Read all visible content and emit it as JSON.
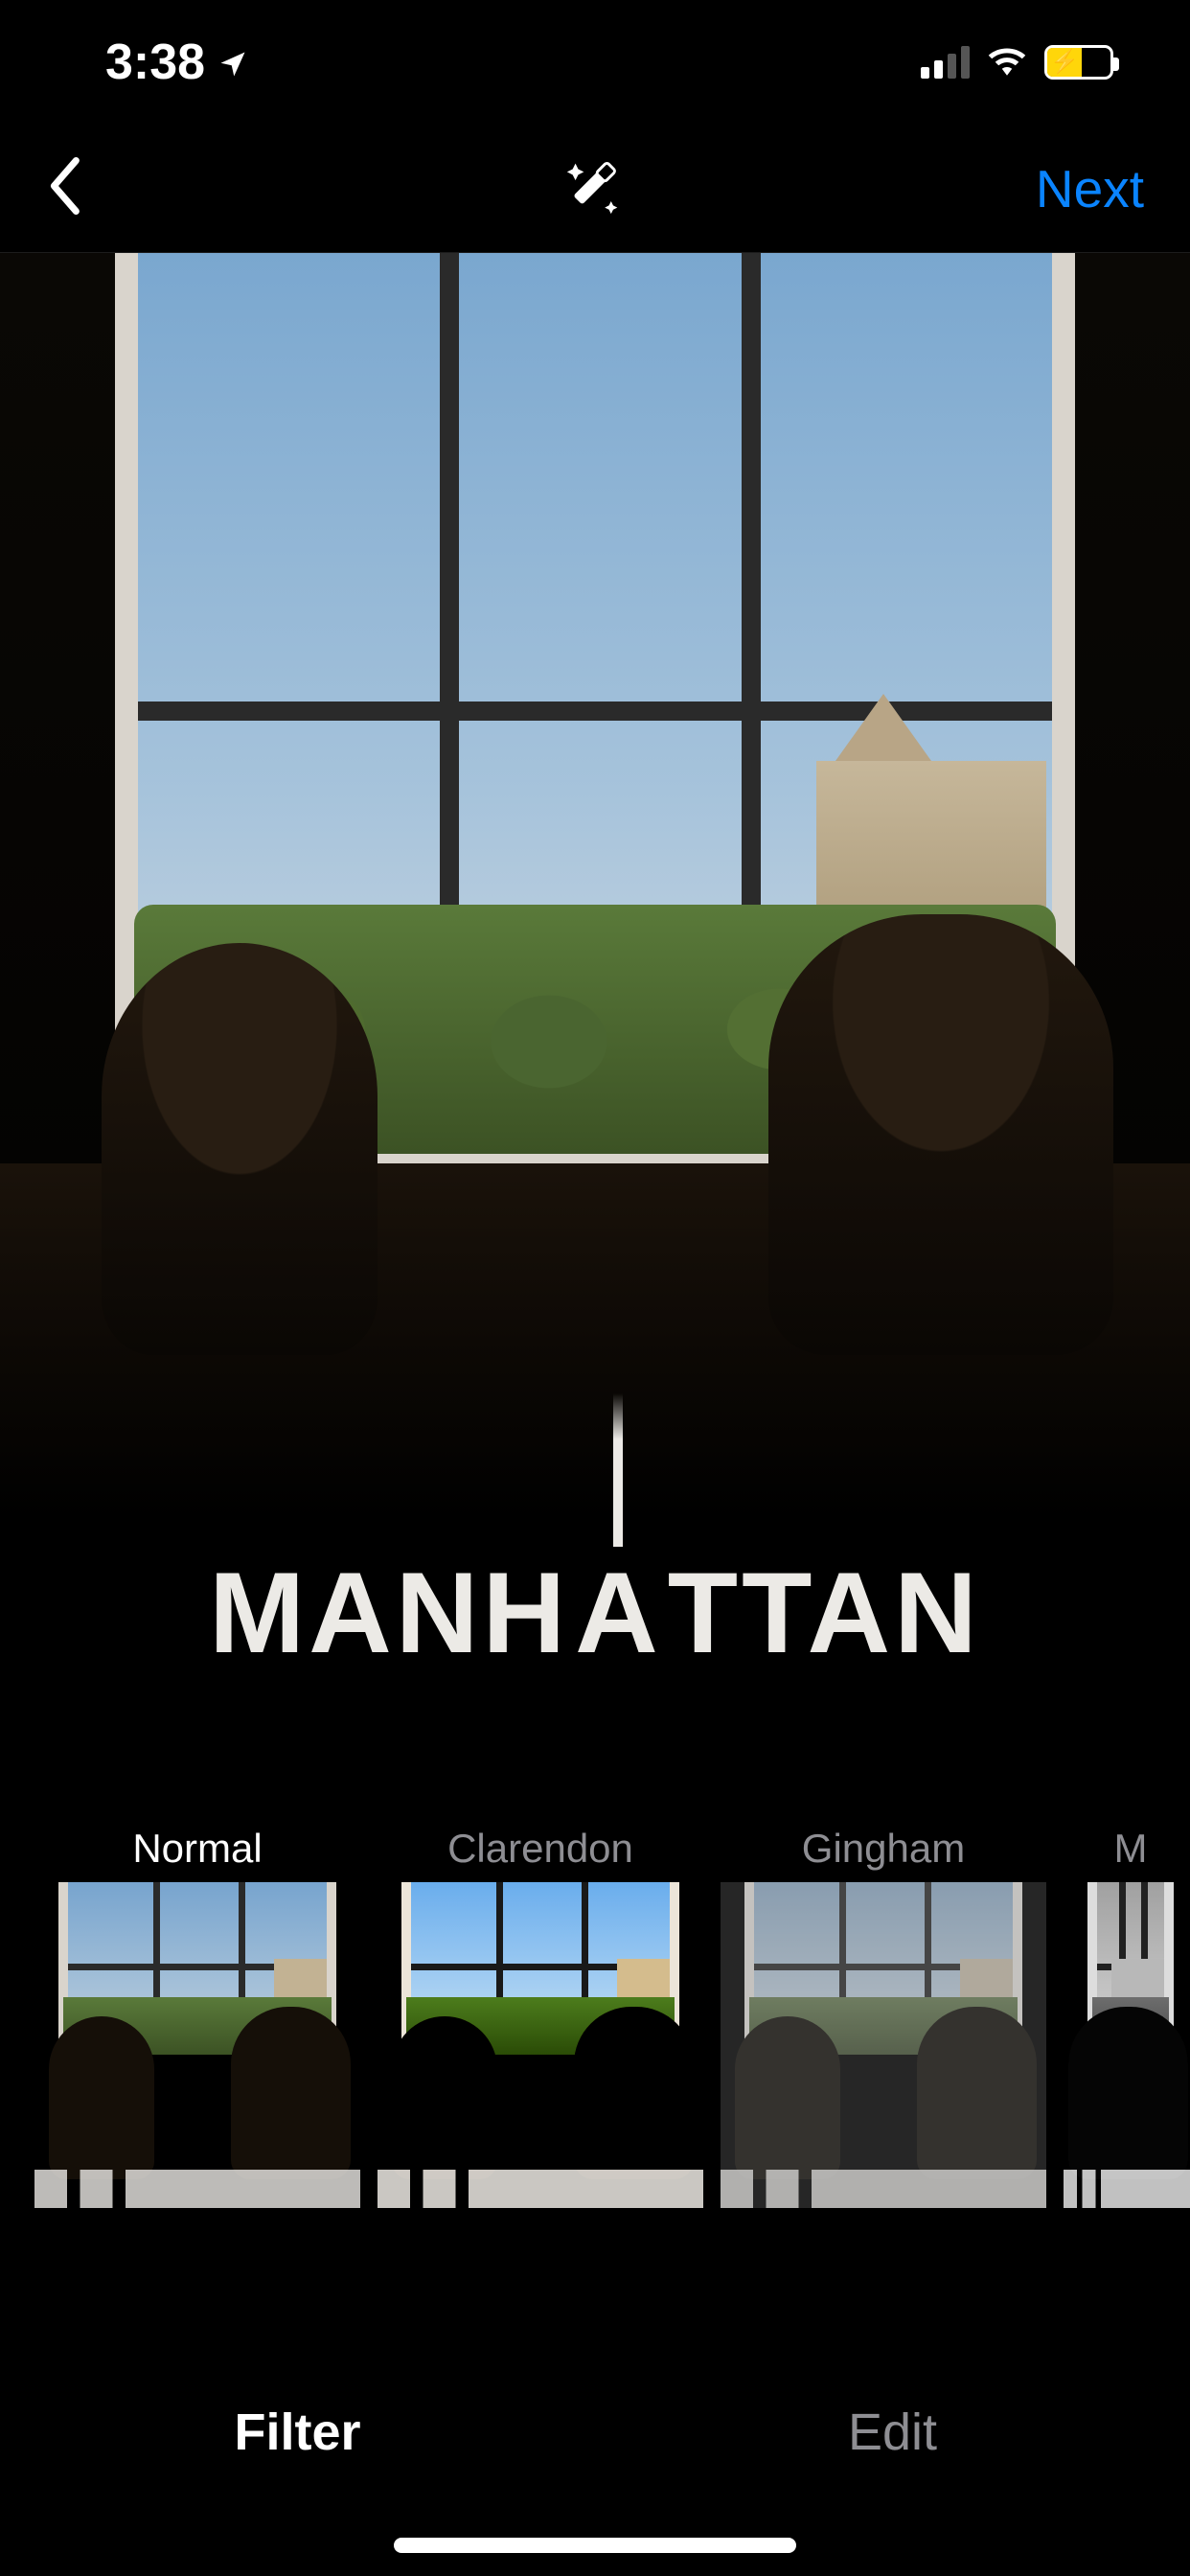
{
  "status": {
    "time": "3:38",
    "location_on": true,
    "signal_bars_active": 2,
    "wifi_on": true,
    "battery_charging": true
  },
  "nav": {
    "back_label": "Back",
    "wand_label": "Auto enhance",
    "next_label": "Next"
  },
  "preview": {
    "overlay_prefix": "M",
    "overlay_middle_before_A": "ANH",
    "overlay_middle_A": "A",
    "overlay_suffix": "TTAN",
    "overlay_full": "MANHATTAN"
  },
  "filters": [
    {
      "label": "Normal",
      "selected": true,
      "cls": "f-normal"
    },
    {
      "label": "Clarendon",
      "selected": false,
      "cls": "f-clarendon"
    },
    {
      "label": "Gingham",
      "selected": false,
      "cls": "f-gingham"
    },
    {
      "label": "M",
      "selected": false,
      "cls": "f-moon",
      "partial": true
    }
  ],
  "tabs": {
    "filter": "Filter",
    "edit": "Edit",
    "active": "filter"
  }
}
